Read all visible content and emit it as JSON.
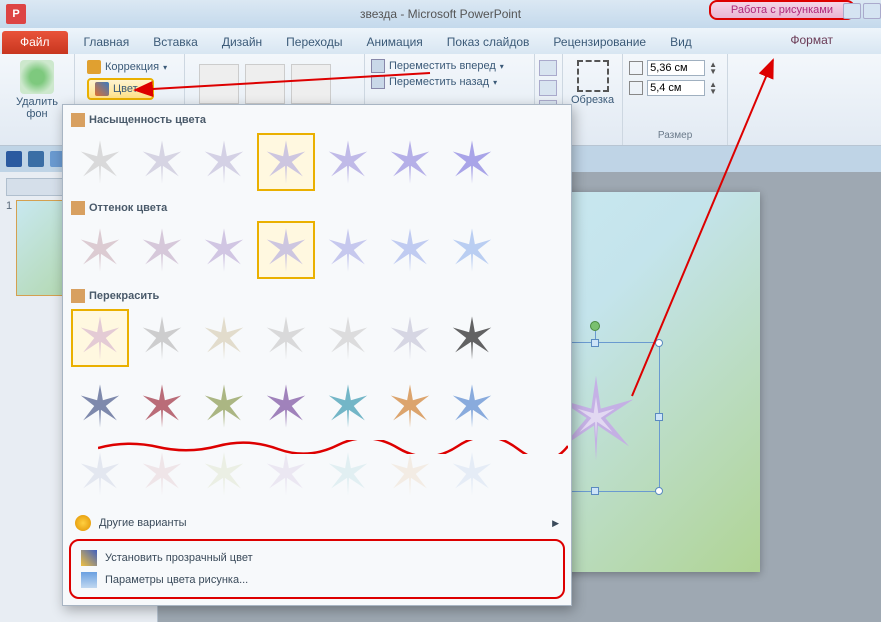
{
  "titlebar": {
    "title": "звезда - Microsoft PowerPoint",
    "picture_tools": "Работа с рисунками",
    "app_letter": "P"
  },
  "tabs": {
    "file": "Файл",
    "home": "Главная",
    "insert": "Вставка",
    "design": "Дизайн",
    "transitions": "Переходы",
    "animations": "Анимация",
    "slideshow": "Показ слайдов",
    "review": "Рецензирование",
    "view": "Вид",
    "format": "Формат"
  },
  "ribbon": {
    "remove_bg": "Удалить фон",
    "corrections": "Коррекция",
    "color": "Цвет",
    "bring_forward": "Переместить вперед",
    "send_backward": "Переместить назад",
    "crop": "Обрезка",
    "size_group": "Размер",
    "height_val": "5,36 см",
    "width_val": "5,4 см"
  },
  "gallery": {
    "saturation": "Насыщенность цвета",
    "tone": "Оттенок цвета",
    "recolor": "Перекрасить",
    "more_variants": "Другие варианты",
    "set_transparent": "Установить прозрачный цвет",
    "options": "Параметры цвета рисунка..."
  },
  "slide_panel": {
    "num": "1"
  }
}
